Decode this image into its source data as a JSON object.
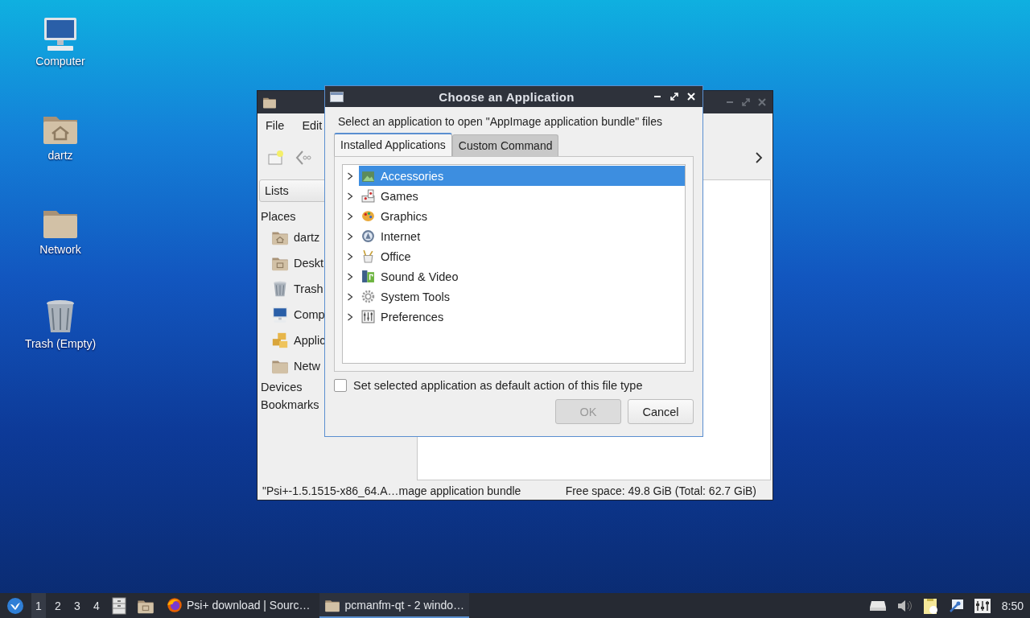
{
  "desktop_icons": [
    {
      "label": "Computer",
      "kind": "computer"
    },
    {
      "label": "dartz",
      "kind": "home"
    },
    {
      "label": "Network",
      "kind": "folder"
    },
    {
      "label": "Trash (Empty)",
      "kind": "trash"
    }
  ],
  "file_manager": {
    "menu": [
      "File",
      "Edit"
    ],
    "side_pane_mode": "Lists",
    "places_heading": "Places",
    "places": [
      {
        "label": "dartz",
        "kind": "home"
      },
      {
        "label": "Deskt",
        "kind": "desktop"
      },
      {
        "label": "Trash",
        "kind": "trash"
      },
      {
        "label": "Comp",
        "kind": "computer"
      },
      {
        "label": "Applic",
        "kind": "apps"
      },
      {
        "label": "Netw",
        "kind": "folder"
      }
    ],
    "sections": [
      "Devices",
      "Bookmarks"
    ],
    "status_left": "\"Psi+-1.5.1515-x86_64.A…mage application bundle",
    "status_right": "Free space: 49.8 GiB (Total: 62.7 GiB)"
  },
  "dialog": {
    "title": "Choose an Application",
    "prompt": "Select an application to open \"AppImage application bundle\" files",
    "tabs": [
      {
        "label": "Installed Applications",
        "selected": true
      },
      {
        "label": "Custom Command",
        "selected": false
      }
    ],
    "categories": [
      {
        "label": "Accessories",
        "kind": "accessories",
        "selected": true
      },
      {
        "label": "Games",
        "kind": "games",
        "selected": false
      },
      {
        "label": "Graphics",
        "kind": "graphics",
        "selected": false
      },
      {
        "label": "Internet",
        "kind": "internet",
        "selected": false
      },
      {
        "label": "Office",
        "kind": "office",
        "selected": false
      },
      {
        "label": "Sound & Video",
        "kind": "media",
        "selected": false
      },
      {
        "label": "System Tools",
        "kind": "system",
        "selected": false
      },
      {
        "label": "Preferences",
        "kind": "preferences",
        "selected": false
      }
    ],
    "default_checkbox": {
      "label": "Set selected application as default action of this file type",
      "checked": false
    },
    "buttons": [
      {
        "label": "OK",
        "disabled": true
      },
      {
        "label": "Cancel",
        "disabled": false
      }
    ]
  },
  "taskbar": {
    "desktops": [
      {
        "label": "1",
        "selected": true
      },
      {
        "label": "2",
        "selected": false
      },
      {
        "label": "3",
        "selected": false
      },
      {
        "label": "4",
        "selected": false
      }
    ],
    "tasks": [
      {
        "label": "Psi+ download | Sourc…",
        "kind": "browser",
        "selected": false
      },
      {
        "label": "pcmanfm-qt - 2 windo…",
        "kind": "folder",
        "selected": true
      }
    ],
    "clock": "8:50"
  }
}
